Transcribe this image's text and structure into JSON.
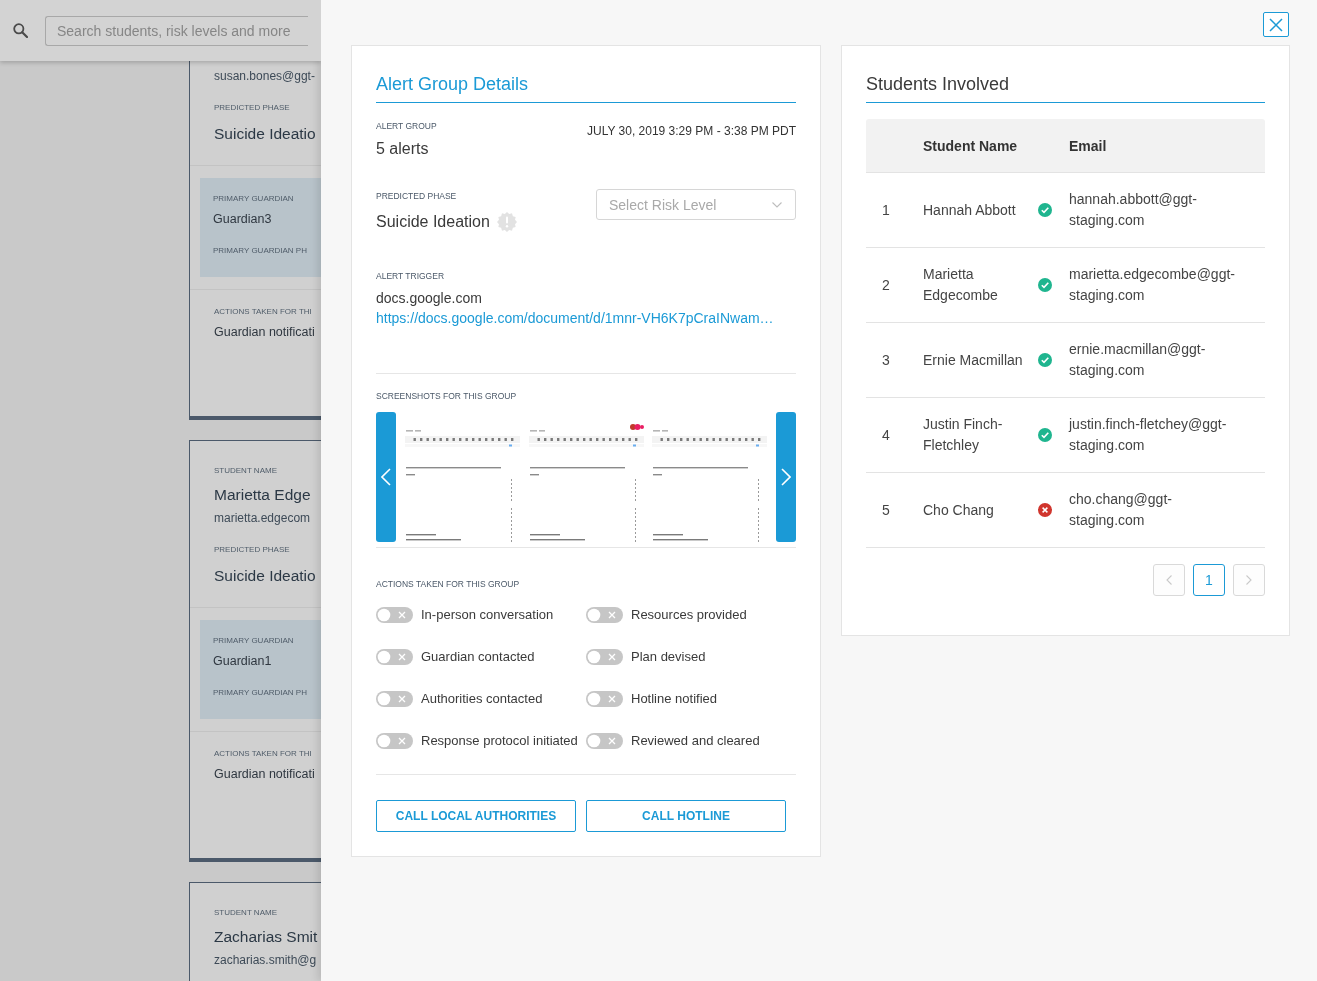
{
  "search": {
    "placeholder": "Search students, risk levels and more"
  },
  "cards": [
    {
      "sections": [
        {
          "kind": "info",
          "lines": [
            {
              "kind": "email",
              "text": "susan.bones@ggt-"
            },
            {
              "kind": "label",
              "text": "PREDICTED PHASE"
            },
            {
              "kind": "phase",
              "text": "Suicide Ideatio"
            }
          ]
        },
        {
          "kind": "guardian",
          "lines": [
            {
              "kind": "label",
              "text": "PRIMARY GUARDIAN"
            },
            {
              "kind": "value",
              "text": "Guardian3"
            },
            {
              "kind": "label",
              "text": "PRIMARY GUARDIAN PH"
            }
          ]
        },
        {
          "kind": "actions",
          "lines": [
            {
              "kind": "label",
              "text": "ACTIONS TAKEN FOR THI"
            },
            {
              "kind": "value",
              "text": "Guardian notificati"
            }
          ]
        }
      ]
    },
    {
      "sections": [
        {
          "kind": "info",
          "lines": [
            {
              "kind": "label",
              "text": "STUDENT NAME"
            },
            {
              "kind": "name",
              "text": "Marietta Edge"
            },
            {
              "kind": "email",
              "text": "marietta.edgecom"
            },
            {
              "kind": "label",
              "text": "PREDICTED PHASE"
            },
            {
              "kind": "phase",
              "text": "Suicide Ideatio"
            }
          ]
        },
        {
          "kind": "guardian",
          "lines": [
            {
              "kind": "label",
              "text": "PRIMARY GUARDIAN"
            },
            {
              "kind": "value",
              "text": "Guardian1"
            },
            {
              "kind": "label",
              "text": "PRIMARY GUARDIAN PH"
            }
          ]
        },
        {
          "kind": "actions",
          "lines": [
            {
              "kind": "label",
              "text": "ACTIONS TAKEN FOR THI"
            },
            {
              "kind": "value",
              "text": "Guardian notificati"
            }
          ]
        }
      ]
    },
    {
      "sections": [
        {
          "kind": "info",
          "lines": [
            {
              "kind": "label",
              "text": "STUDENT NAME"
            },
            {
              "kind": "name",
              "text": "Zacharias Smit"
            },
            {
              "kind": "email",
              "text": "zacharias.smith@g"
            }
          ]
        }
      ]
    }
  ],
  "alert_group_details": {
    "title": "Alert Group Details",
    "alert_group": {
      "label": "ALERT GROUP",
      "value": "5 alerts",
      "time_range": "JULY 30, 2019 3:29 PM - 3:38 PM PDT"
    },
    "predicted_phase": {
      "label": "PREDICTED PHASE",
      "value": "Suicide Ideation"
    },
    "risk_level_select": {
      "placeholder": "Select Risk Level"
    },
    "alert_trigger": {
      "label": "ALERT TRIGGER",
      "site": "docs.google.com",
      "url": "https://docs.google.com/document/d/1mnr-VH6K7pCraINwam…"
    },
    "screenshots": {
      "label": "SCREENSHOTS FOR THIS GROUP",
      "thumbnails": [
        {
          "logo": false
        },
        {
          "logo": true
        },
        {
          "logo": false
        }
      ]
    },
    "actions": {
      "label": "ACTIONS TAKEN FOR THIS GROUP",
      "toggles": [
        {
          "label": "In-person conversation",
          "on": false
        },
        {
          "label": "Resources provided",
          "on": false
        },
        {
          "label": "Guardian contacted",
          "on": false
        },
        {
          "label": "Plan devised",
          "on": false
        },
        {
          "label": "Authorities contacted",
          "on": false
        },
        {
          "label": "Hotline notified",
          "on": false
        },
        {
          "label": "Response protocol initiated",
          "on": false
        },
        {
          "label": "Reviewed and cleared",
          "on": false
        }
      ]
    },
    "buttons": [
      "CALL LOCAL AUTHORITIES",
      "CALL HOTLINE"
    ]
  },
  "students_involved": {
    "title": "Students Involved",
    "columns": [
      "Student Name",
      "Email"
    ],
    "rows": [
      {
        "number": "1",
        "name": "Hannah Abbott",
        "verified": true,
        "email": "hannah.abbott@ggt-staging.com"
      },
      {
        "number": "2",
        "name": "Marietta Edgecombe",
        "verified": true,
        "email": "marietta.edgecombe@ggt-staging.com"
      },
      {
        "number": "3",
        "name": "Ernie Macmillan",
        "verified": true,
        "email": "ernie.macmillan@ggt-staging.com"
      },
      {
        "number": "4",
        "name": "Justin Finch-Fletchley",
        "verified": true,
        "email": "justin.finch-fletchey@ggt-staging.com"
      },
      {
        "number": "5",
        "name": "Cho Chang",
        "verified": false,
        "email": "cho.chang@ggt-staging.com"
      }
    ],
    "pagination": {
      "previous_disabled": true,
      "pages": [
        {
          "label": "1",
          "selected": true
        }
      ],
      "next_disabled": true
    }
  }
}
